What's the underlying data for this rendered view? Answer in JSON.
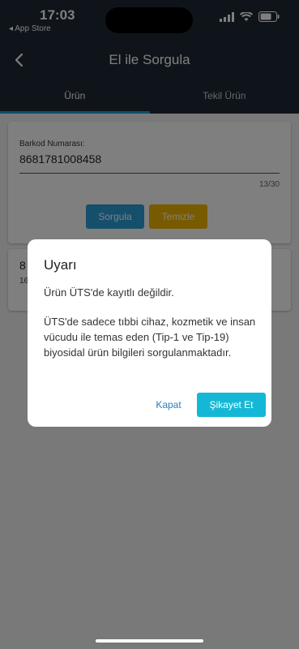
{
  "status": {
    "time": "17:03",
    "back_app": "◂ App Store"
  },
  "header": {
    "title": "El ile Sorgula"
  },
  "tabs": [
    {
      "label": "Ürün"
    },
    {
      "label": "Tekil Ürün"
    }
  ],
  "form": {
    "barcode_label": "Barkod Numarası:",
    "barcode_value": "8681781008458",
    "counter": "13/30",
    "query_label": "Sorgula",
    "clear_label": "Temizle"
  },
  "result": {
    "line1": "8",
    "line2": "16"
  },
  "dialog": {
    "title": "Uyarı",
    "message1": "Ürün ÜTS'de kayıtlı değildir.",
    "message2": "ÜTS'de sadece tıbbi cihaz, kozmetik ve insan vücudu ile temas eden (Tip-1 ve Tip-19) biyosidal ürün bilgileri sorgulanmaktadır.",
    "close_label": "Kapat",
    "complain_label": "Şikayet Et"
  },
  "colors": {
    "header_bg": "#1f2935",
    "primary": "#2a9fd6",
    "warning": "#f0b400",
    "accent": "#14b8d6"
  }
}
